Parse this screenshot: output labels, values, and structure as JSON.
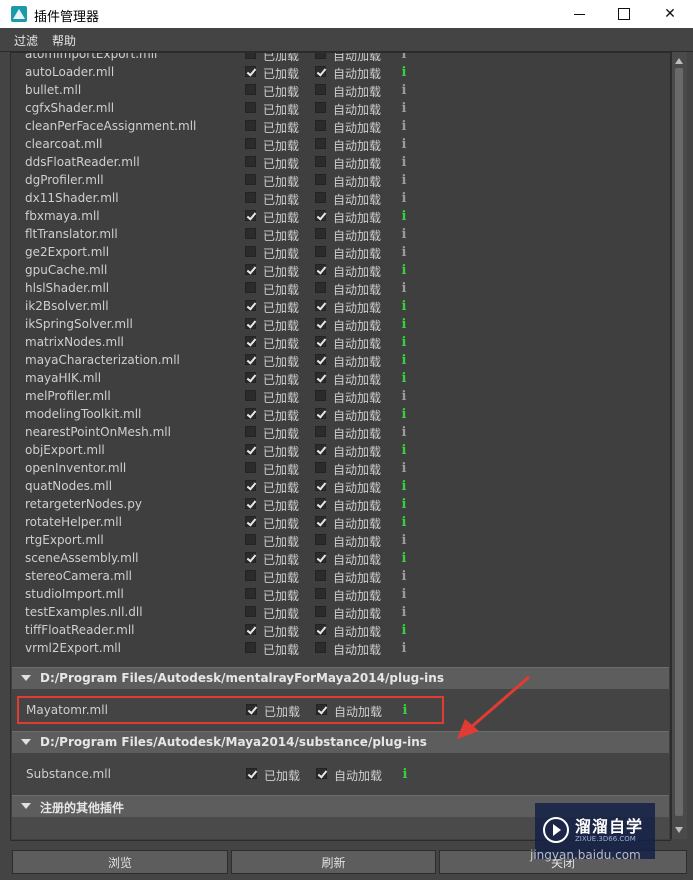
{
  "window": {
    "title": "插件管理器"
  },
  "menu": {
    "items": [
      "过滤",
      "帮助"
    ]
  },
  "labels": {
    "loaded": "已加载",
    "auto_load": "自动加载",
    "info_glyph": "i"
  },
  "section1": {
    "partial_top_name": "atomImportExport.mll",
    "plugins": [
      {
        "name": "autoLoader.mll",
        "loaded": true,
        "auto": true
      },
      {
        "name": "bullet.mll",
        "loaded": false,
        "auto": false
      },
      {
        "name": "cgfxShader.mll",
        "loaded": false,
        "auto": false
      },
      {
        "name": "cleanPerFaceAssignment.mll",
        "loaded": false,
        "auto": false
      },
      {
        "name": "clearcoat.mll",
        "loaded": false,
        "auto": false
      },
      {
        "name": "ddsFloatReader.mll",
        "loaded": false,
        "auto": false
      },
      {
        "name": "dgProfiler.mll",
        "loaded": false,
        "auto": false
      },
      {
        "name": "dx11Shader.mll",
        "loaded": false,
        "auto": false
      },
      {
        "name": "fbxmaya.mll",
        "loaded": true,
        "auto": true
      },
      {
        "name": "fltTranslator.mll",
        "loaded": false,
        "auto": false
      },
      {
        "name": "ge2Export.mll",
        "loaded": false,
        "auto": false
      },
      {
        "name": "gpuCache.mll",
        "loaded": true,
        "auto": true
      },
      {
        "name": "hlslShader.mll",
        "loaded": false,
        "auto": false
      },
      {
        "name": "ik2Bsolver.mll",
        "loaded": true,
        "auto": true
      },
      {
        "name": "ikSpringSolver.mll",
        "loaded": true,
        "auto": true
      },
      {
        "name": "matrixNodes.mll",
        "loaded": true,
        "auto": true
      },
      {
        "name": "mayaCharacterization.mll",
        "loaded": true,
        "auto": true
      },
      {
        "name": "mayaHIK.mll",
        "loaded": true,
        "auto": true
      },
      {
        "name": "melProfiler.mll",
        "loaded": false,
        "auto": false
      },
      {
        "name": "modelingToolkit.mll",
        "loaded": true,
        "auto": true
      },
      {
        "name": "nearestPointOnMesh.mll",
        "loaded": false,
        "auto": false
      },
      {
        "name": "objExport.mll",
        "loaded": true,
        "auto": true
      },
      {
        "name": "openInventor.mll",
        "loaded": false,
        "auto": false
      },
      {
        "name": "quatNodes.mll",
        "loaded": true,
        "auto": true
      },
      {
        "name": "retargeterNodes.py",
        "loaded": true,
        "auto": true
      },
      {
        "name": "rotateHelper.mll",
        "loaded": true,
        "auto": true
      },
      {
        "name": "rtgExport.mll",
        "loaded": false,
        "auto": false
      },
      {
        "name": "sceneAssembly.mll",
        "loaded": true,
        "auto": true
      },
      {
        "name": "stereoCamera.mll",
        "loaded": false,
        "auto": false
      },
      {
        "name": "studioImport.mll",
        "loaded": false,
        "auto": false
      },
      {
        "name": "testExamples.nll.dll",
        "loaded": false,
        "auto": false
      },
      {
        "name": "tiffFloatReader.mll",
        "loaded": true,
        "auto": true
      },
      {
        "name": "vrml2Export.mll",
        "loaded": false,
        "auto": false
      }
    ]
  },
  "section2": {
    "title": "D:/Program Files/Autodesk/mentalrayForMaya2014/plug-ins",
    "plugin": {
      "name": "Mayatomr.mll",
      "loaded": true,
      "auto": true
    }
  },
  "section3": {
    "title": "D:/Program Files/Autodesk/Maya2014/substance/plug-ins",
    "plugin": {
      "name": "Substance.mll",
      "loaded": true,
      "auto": true
    }
  },
  "section4": {
    "title": "注册的其他插件"
  },
  "buttons": {
    "browse": "浏览",
    "refresh": "刷新",
    "close": "关闭"
  },
  "watermark": {
    "title": "溜溜自学",
    "url": "ZIXUE.3D66.COM",
    "overlay": "jingyan.baidu.com"
  },
  "colors": {
    "info_active": "#39d139",
    "info_inactive": "#9a9a9a",
    "highlight": "#e13b33"
  }
}
